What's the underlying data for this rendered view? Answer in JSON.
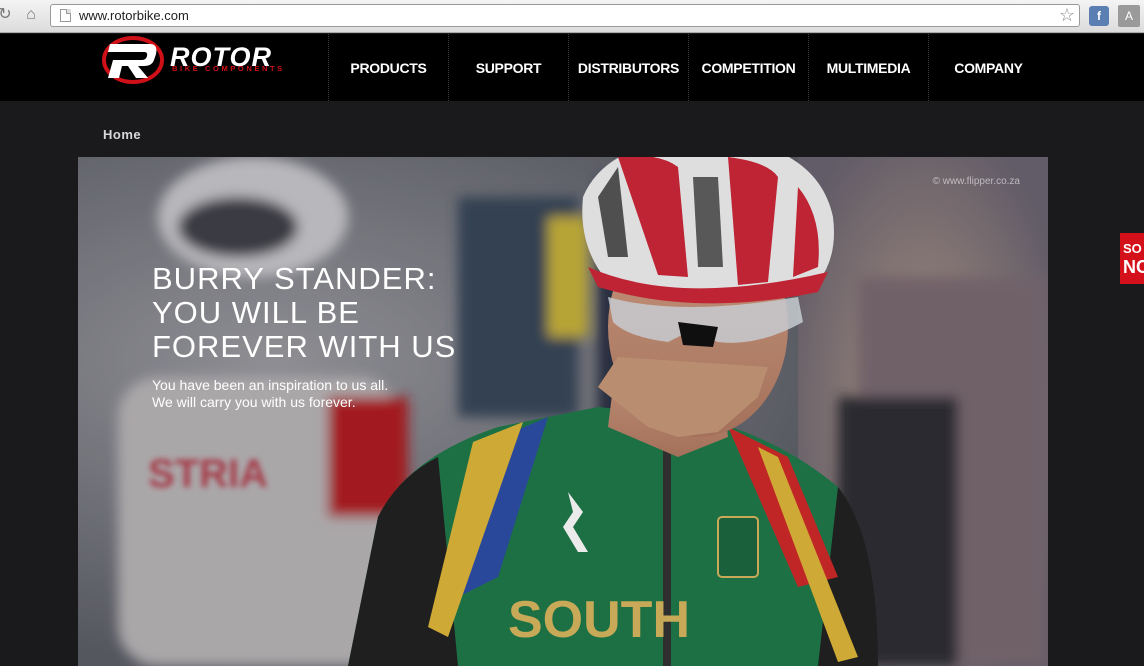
{
  "browser": {
    "url": "www.rotorbike.com",
    "icons": [
      "reload-icon",
      "home-icon",
      "page-icon",
      "star-icon"
    ]
  },
  "header": {
    "logo_word": "ROTOR",
    "logo_sub": "BIKE COMPONENTS",
    "menu": [
      "PRODUCTS",
      "SUPPORT",
      "DISTRIBUTORS",
      "COMPETITION",
      "MULTIMEDIA",
      "COMPANY"
    ]
  },
  "breadcrumb": "Home",
  "hero": {
    "credit": "© www.flipper.co.za",
    "title": "BURRY STANDER:\nYOU WILL BE\nFOREVER WITH US",
    "text": "You have been an inspiration to us all.\nWe will carry you with us forever."
  },
  "side_tab": {
    "line1": "SO",
    "line2": "NC"
  },
  "colors": {
    "brand_red": "#d01018",
    "header_bg": "#000000",
    "page_bg": "#1a1a1c"
  }
}
